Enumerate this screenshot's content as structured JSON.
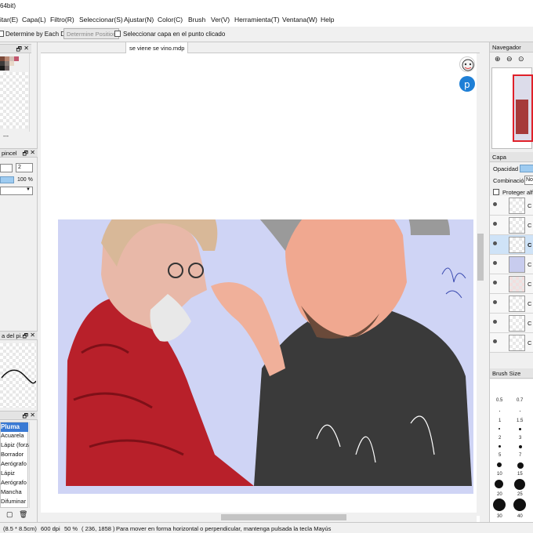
{
  "window": {
    "title": "64bit)"
  },
  "menu": [
    "itar(E)",
    "Capa(L)",
    "Filtro(R)",
    "Seleccionar(S)",
    "Ajustar(N)",
    "Color(C)",
    "Brush",
    "Ver(V)",
    "Herramienta(T)",
    "Ventana(W)",
    "Help"
  ],
  "options": {
    "determine_each_drag": "Determine by Each Drag",
    "determine_position": "Determine Position",
    "select_layer_clicked": "Seleccionar capa en el punto clicado"
  },
  "left": {
    "dashes": "---",
    "brush_panel_title": "pincel",
    "brush_size_value": "2",
    "opacity_value": "100 %",
    "stroke_panel_title": "a del pi...",
    "brush_list": [
      "Pluma",
      "Acuarela",
      "Lápiz (forza",
      "Borrador",
      "Aerógrafo",
      "Lápiz",
      "Aerógrafo",
      "Mancha",
      "Difuminar"
    ],
    "pin": "🗗",
    "close": "✕"
  },
  "canvas": {
    "tab_title": "se viene se vino.mdp"
  },
  "right": {
    "navigator_title": "Navegador",
    "layer_title": "Capa",
    "opacity_label": "Opacidad",
    "blend_label": "Combinación",
    "blend_value": "No",
    "protect_label": "Proteger alfi",
    "layer_rows": [
      "C",
      "C",
      "C",
      "C",
      "C",
      "C",
      "C",
      "C"
    ],
    "brush_size_title": "Brush Size",
    "brush_sizes": [
      "0.5",
      "0.7",
      "1",
      "1.5",
      "2",
      "3",
      "5",
      "7",
      "10",
      "15",
      "20",
      "25",
      "30",
      "40",
      "50",
      "60",
      "70",
      "80"
    ]
  },
  "status": {
    "size": "(8.5 * 8.5cm)",
    "dpi": "600 dpi",
    "zoom": "50 %",
    "coords": "( 236, 1858 )",
    "hint": "Para mover en forma horizontal o perpendicular, mantenga pulsada la tecla Mayús"
  },
  "colors": {
    "art_background": "#cfd4f5",
    "accent_blue": "#1e7fd6",
    "nav_highlight": "#e0202a"
  }
}
